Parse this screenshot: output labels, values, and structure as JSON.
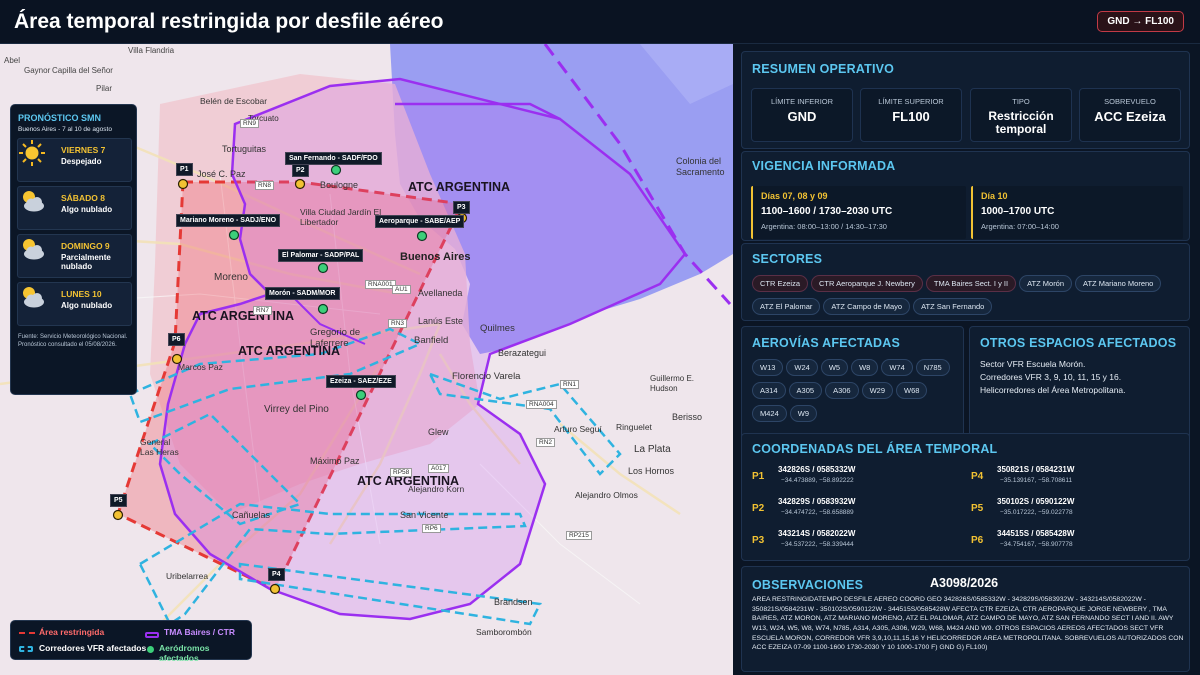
{
  "header": {
    "title": "Área temporal restringida por desfile aéreo",
    "badge": "GND → FL100"
  },
  "weather": {
    "title": "PRONÓSTICO SMN",
    "subtitle": "Buenos Aires - 7 al 10 de agosto",
    "days": [
      {
        "day": "VIERNES 7",
        "status": "Despejado",
        "icon": "sun-icon"
      },
      {
        "day": "SÁBADO 8",
        "status": "Algo nublado",
        "icon": "partly-cloudy-icon"
      },
      {
        "day": "DOMINGO 9",
        "status": "Parcialmente nublado",
        "icon": "partly-cloudy-icon"
      },
      {
        "day": "LUNES 10",
        "status": "Algo nublado",
        "icon": "partly-cloudy-icon"
      }
    ],
    "source": "Fuente: Servicio Meteorológico Nacional. Pronóstico consultado el 05/08/2026."
  },
  "legend": {
    "restricted": "Área restringida",
    "tma": "TMA Baires / CTR",
    "vfr": "Corredores VFR afectados",
    "aerodromes": "Aeródromos afectados"
  },
  "map": {
    "atc_labels": [
      "ATC ARGENTINA",
      "ATC ARGENTINA",
      "ATC ARGENTINA",
      "ATC ARGENTINA"
    ],
    "points": [
      "P1",
      "P2",
      "P3",
      "P4",
      "P5",
      "P6"
    ],
    "aerodromes": [
      "San Fernando - SADF/FDO",
      "Mariano Moreno - SADJ/ENO",
      "Aeroparque - SABE/AEP",
      "El Palomar - SADP/PAL",
      "Morón - SADM/MOR",
      "Ezeiza - SAEZ/EZE"
    ],
    "places": [
      "Capilla del Señor",
      "Pilar",
      "Belén de Escobar",
      "Torcuato",
      "José C. Paz",
      "Tortuguitas",
      "Boulogne",
      "Villa Ciudad Jardín El Libertador",
      "Buenos Aires",
      "Moreno",
      "Avellaneda",
      "Lanús Este",
      "Quilmes",
      "Banfield",
      "Berazategui",
      "Gregorio de Laferrere",
      "Florencio Varela",
      "Virrey del Pino",
      "Glew",
      "Máximo Paz",
      "Cañuelas",
      "Alejandro Korn",
      "San Vicente",
      "Berisso",
      "La Plata",
      "Los Hornos",
      "Arturo Seguí",
      "Ringuelet",
      "Colonia del Sacramento",
      "General Las Heras",
      "Marcos Paz",
      "Guillermo E. Hudson",
      "Uribelarrea",
      "Brandsen",
      "Samborombón",
      "Abel",
      "Gaynor",
      "Villa Flandria",
      "Alejandro Olmos"
    ],
    "routes": [
      "RN9",
      "RN8",
      "RN7",
      "RNA001",
      "RN1",
      "RN2",
      "RP6",
      "RP58",
      "RP215",
      "A017",
      "AU1",
      "RNA004",
      "RN3"
    ]
  },
  "resumen": {
    "title": "RESUMEN OPERATIVO",
    "items": [
      {
        "label": "LÍMITE INFERIOR",
        "value": "GND"
      },
      {
        "label": "LÍMITE SUPERIOR",
        "value": "FL100"
      },
      {
        "label": "TIPO",
        "value": "Restricción temporal"
      },
      {
        "label": "SOBREVUELO",
        "value": "ACC Ezeiza"
      }
    ]
  },
  "vigencia": {
    "title": "VIGENCIA INFORMADA",
    "blocks": [
      {
        "days": "Días 07, 08 y 09",
        "hours": "1100–1600 / 1730–2030 UTC",
        "local": "Argentina: 08:00–13:00 / 14:30–17:30"
      },
      {
        "days": "Día 10",
        "hours": "1000–1700 UTC",
        "local": "Argentina: 07:00–14:00"
      }
    ]
  },
  "sectores": {
    "title": "SECTORES",
    "chips": [
      "CTR Ezeiza",
      "CTR Aeroparque J. Newbery",
      "TMA Baires Sect. I y II",
      "ATZ Morón",
      "ATZ Mariano Moreno",
      "ATZ El Palomar",
      "ATZ Campo de Mayo",
      "ATZ San Fernando"
    ]
  },
  "aerovias": {
    "title": "AEROVÍAS AFECTADAS",
    "chips": [
      "W13",
      "W24",
      "W5",
      "W8",
      "W74",
      "N785",
      "A314",
      "A305",
      "A306",
      "W29",
      "W68",
      "M424",
      "W9"
    ]
  },
  "otros": {
    "title": "OTROS ESPACIOS AFECTADOS",
    "lines": [
      "Sector VFR Escuela Morón.",
      "Corredores VFR 3, 9, 10, 11, 15 y 16.",
      "Helicorredores del Área Metropolitana."
    ]
  },
  "coordenadas": {
    "title": "COORDENADAS DEL ÁREA TEMPORAL",
    "points": [
      {
        "id": "P1",
        "coord": "342826S / 0585332W",
        "dec": "−34.473889, −58.892222"
      },
      {
        "id": "P4",
        "coord": "350821S / 0584231W",
        "dec": "−35.139167, −58.708611"
      },
      {
        "id": "P2",
        "coord": "342829S / 0583932W",
        "dec": "−34.474722, −58.658889"
      },
      {
        "id": "P5",
        "coord": "350102S / 0590122W",
        "dec": "−35.017222, −59.022778"
      },
      {
        "id": "P3",
        "coord": "343214S / 0582022W",
        "dec": "−34.537222, −58.339444"
      },
      {
        "id": "P6",
        "coord": "344515S / 0585428W",
        "dec": "−34.754167, −58.907778"
      }
    ]
  },
  "observaciones": {
    "title": "OBSERVACIONES",
    "code": "A3098/2026",
    "text": "AREA RESTRINGIDATEMPO DESFILE AEREO COORD GEO 342826S/0585332W - 342829S/0583932W - 343214S/0582022W - 350821S/0584231W - 350102S/0590122W - 344515S/0585428W AFECTA CTR EZEIZA, CTR AEROPARQUE JORGE NEWBERY , TMA BAIRES, ATZ MORON, ATZ MARIANO MORENO, ATZ EL PALOMAR, ATZ CAMPO DE MAYO, ATZ SAN FERNANDO SECT I AND II. AWY W13, W24, W5, W8, W74, N785, A314, A305, A306, W29, W68, M424 AND W9. OTROS ESPACIOS AEREOS AFECTADOS SECT VFR ESCUELA MORON, CORREDOR VFR 3,9,10,11,15,16 Y HELICORREDOR AREA METROPOLITANA. SOBREVUELOS AUTORIZADOS CON ACC EZEIZA 07-09 1100-1600 1730-2030 Y 10 1000-1700 F) GND G) FL100)"
  },
  "colors": {
    "restricted": "#e53935",
    "tma": "#9b2ff0",
    "vfr": "#2fb3e0",
    "aerodrome": "#3ccf7a",
    "accent": "#5cc7f0",
    "highlight": "#f2c233"
  }
}
